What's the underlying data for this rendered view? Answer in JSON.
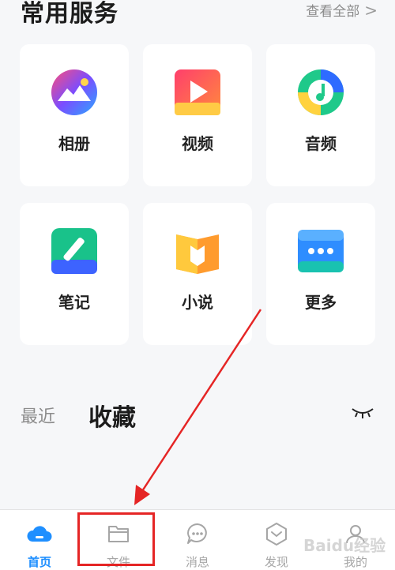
{
  "header": {
    "title": "常用服务",
    "view_all": "查看全部",
    "chevron": ">"
  },
  "services": [
    {
      "label": "相册",
      "icon": "photo-album-icon"
    },
    {
      "label": "视频",
      "icon": "video-play-icon"
    },
    {
      "label": "音频",
      "icon": "music-note-icon"
    },
    {
      "label": "笔记",
      "icon": "pencil-note-icon"
    },
    {
      "label": "小说",
      "icon": "open-book-icon"
    },
    {
      "label": "更多",
      "icon": "more-dots-icon"
    }
  ],
  "tabs": {
    "recent": "最近",
    "favorites": "收藏"
  },
  "bottom_nav": [
    {
      "label": "首页",
      "icon": "cloud-home-icon",
      "active": true
    },
    {
      "label": "文件",
      "icon": "folder-icon",
      "active": false
    },
    {
      "label": "消息",
      "icon": "chat-bubble-icon",
      "active": false
    },
    {
      "label": "发现",
      "icon": "discover-hexagon-icon",
      "active": false
    },
    {
      "label": "我的",
      "icon": "profile-icon",
      "active": false
    }
  ],
  "watermark": "Baidu经验",
  "colors": {
    "accent": "#1f8fff",
    "annotation": "#e52525",
    "background": "#f6f7f9"
  }
}
